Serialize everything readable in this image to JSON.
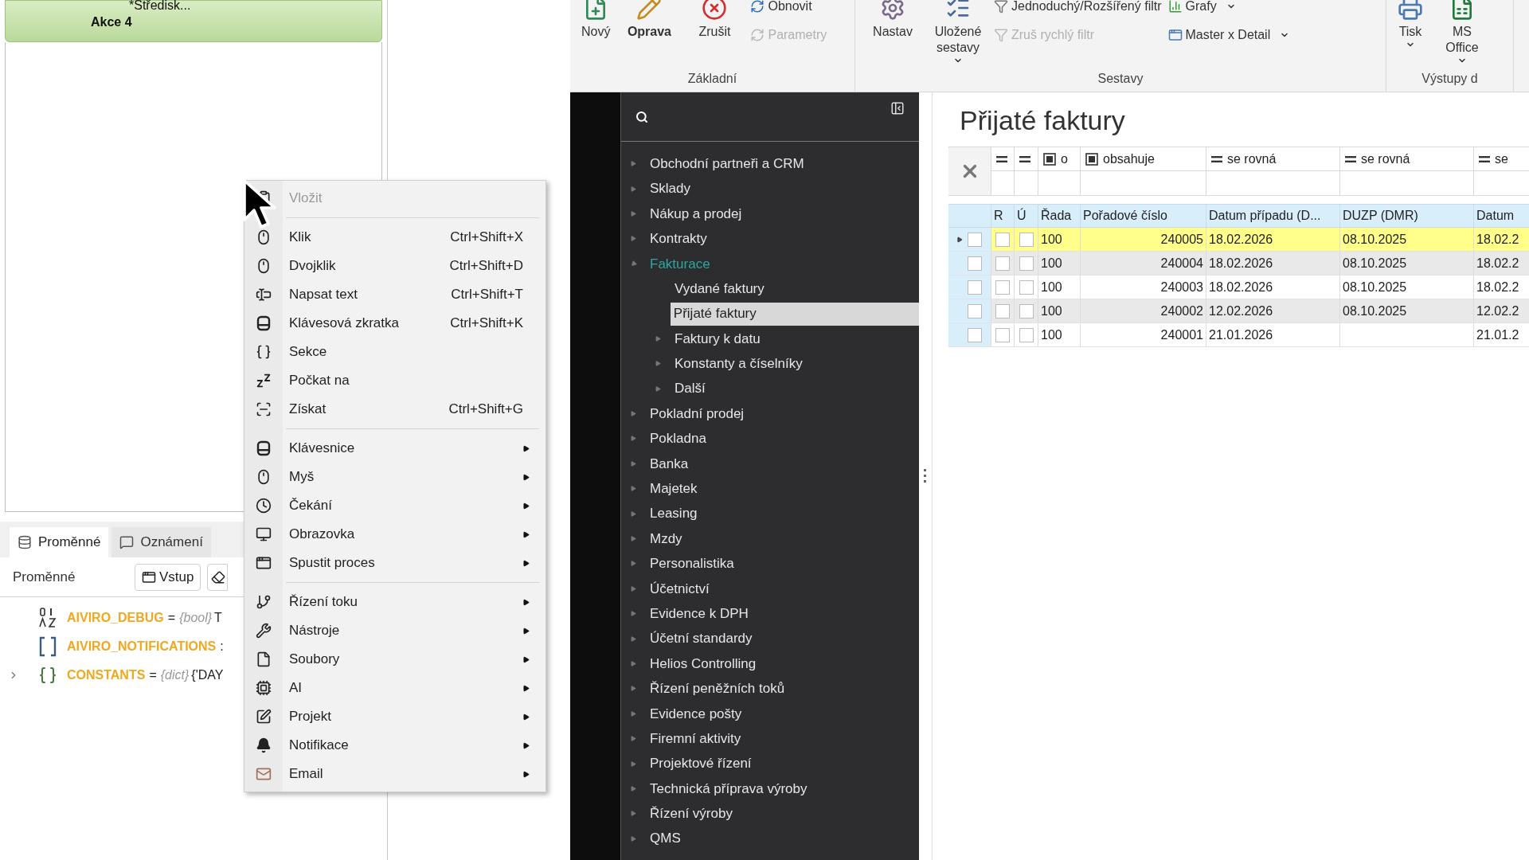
{
  "designer": {
    "card": {
      "lines": [
        "*Středisk...",
        "Akce 4"
      ]
    },
    "tabs": [
      {
        "label": "Proměnné",
        "selected": true
      },
      {
        "label": "Oznámení",
        "selected": false
      }
    ],
    "toolbar": {
      "label": "Proměnné",
      "buttons": [
        {
          "kind": "input",
          "label": "Vstup"
        },
        {
          "kind": "erase"
        }
      ]
    },
    "variables": [
      {
        "kind": "bool",
        "name": "AIVIRO_DEBUG",
        "sep": "=",
        "type": "{bool}",
        "value": "T"
      },
      {
        "kind": "list",
        "name": "AIVIRO_NOTIFICATIONS",
        "sep": ":"
      },
      {
        "kind": "dict",
        "name": "CONSTANTS",
        "sep": "=",
        "type": "{dict}",
        "value": "{'DAY",
        "expanded": false
      }
    ]
  },
  "menu": {
    "sections": [
      {
        "items": [
          {
            "label": "Vložit",
            "disabled": true,
            "submenu": false
          }
        ]
      },
      {
        "items": [
          {
            "label": "Klik",
            "shortcut": "Ctrl+Shift+X",
            "disabled": false,
            "submenu": false
          },
          {
            "label": "Dvojklik",
            "shortcut": "Ctrl+Shift+D",
            "disabled": false,
            "submenu": false
          },
          {
            "label": "Napsat text",
            "shortcut": "Ctrl+Shift+T",
            "disabled": false,
            "submenu": false
          },
          {
            "label": "Klávesová zkratka",
            "shortcut": "Ctrl+Shift+K",
            "disabled": false,
            "submenu": false
          },
          {
            "label": "Sekce",
            "disabled": false,
            "submenu": false
          },
          {
            "label": "Počkat na",
            "disabled": false,
            "submenu": false
          },
          {
            "label": "Získat",
            "shortcut": "Ctrl+Shift+G",
            "disabled": false,
            "submenu": false
          }
        ]
      },
      {
        "items": [
          {
            "label": "Klávesnice",
            "disabled": false,
            "submenu": true
          },
          {
            "label": "Myš",
            "disabled": false,
            "submenu": true
          },
          {
            "label": "Čekání",
            "disabled": false,
            "submenu": true
          },
          {
            "label": "Obrazovka",
            "disabled": false,
            "submenu": true
          },
          {
            "label": "Spustit proces",
            "disabled": false,
            "submenu": true
          }
        ]
      },
      {
        "items": [
          {
            "label": "Řízení toku",
            "disabled": false,
            "submenu": true
          },
          {
            "label": "Nástroje",
            "disabled": false,
            "submenu": true
          },
          {
            "label": "Soubory",
            "disabled": false,
            "submenu": true
          },
          {
            "label": "AI",
            "disabled": false,
            "submenu": true
          },
          {
            "label": "Projekt",
            "disabled": false,
            "submenu": true
          },
          {
            "label": "Notifikace",
            "disabled": false,
            "submenu": true
          },
          {
            "label": "Email",
            "disabled": false,
            "submenu": true
          }
        ]
      }
    ]
  },
  "ribbon": {
    "groups": [
      {
        "label": "Základní",
        "columns": [
          [
            {
              "kind": "large",
              "label": "Nový",
              "disabled": false,
              "primary": false,
              "dropdown": false
            }
          ],
          [
            {
              "kind": "large",
              "label": "Oprava",
              "disabled": false,
              "primary": true,
              "dropdown": false
            }
          ],
          [
            {
              "kind": "large",
              "label": "Zrušit",
              "disabled": false,
              "primary": false,
              "dropdown": false
            }
          ],
          [
            {
              "kind": "small",
              "label": "Obnovit",
              "disabled": false,
              "primary": false,
              "dropdown": false
            },
            {
              "kind": "small",
              "label": "Parametry",
              "disabled": true,
              "primary": false,
              "dropdown": false
            }
          ]
        ]
      },
      {
        "label": "Sestavy",
        "columns": [
          [
            {
              "kind": "large",
              "label": "Nastav",
              "disabled": false,
              "primary": false,
              "dropdown": false
            }
          ],
          [
            {
              "kind": "large",
              "label": "Uložené sestavy",
              "disabled": false,
              "primary": false,
              "dropdown": true
            }
          ],
          [
            {
              "kind": "small",
              "label": "Jednoduchý/Rozšířený filtr",
              "disabled": false,
              "primary": false,
              "dropdown": false
            },
            {
              "kind": "small",
              "label": "Zruš rychlý filtr",
              "disabled": true,
              "primary": false,
              "dropdown": false
            }
          ],
          [
            {
              "kind": "small",
              "label": "Grafy",
              "disabled": false,
              "primary": false,
              "dropdown": true
            },
            {
              "kind": "small",
              "label": "Master x Detail",
              "disabled": false,
              "primary": false,
              "dropdown": true
            }
          ]
        ]
      },
      {
        "label": "Výstupy d",
        "columns": [
          [
            {
              "kind": "large",
              "label": "Tisk",
              "disabled": false,
              "primary": false,
              "dropdown": true
            }
          ],
          [
            {
              "kind": "large",
              "label": "MS Office",
              "disabled": false,
              "primary": false,
              "dropdown": true
            }
          ]
        ]
      }
    ]
  },
  "navigation": {
    "items": [
      {
        "label": "Obchodní partneři a CRM",
        "kind": "branch",
        "expanded": false,
        "selected": false
      },
      {
        "label": "Sklady",
        "kind": "branch",
        "expanded": false,
        "selected": false
      },
      {
        "label": "Nákup a prodej",
        "kind": "branch",
        "expanded": false,
        "selected": false
      },
      {
        "label": "Kontrakty",
        "kind": "branch",
        "expanded": false,
        "selected": false
      },
      {
        "label": "Fakturace",
        "kind": "branch",
        "expanded": true,
        "selected": false,
        "children": [
          {
            "label": "Vydané faktury",
            "kind": "leaf",
            "expanded": false,
            "selected": false
          },
          {
            "label": "Přijaté faktury",
            "kind": "leaf",
            "expanded": false,
            "selected": true
          },
          {
            "label": "Faktury k datu",
            "kind": "branch",
            "expanded": false,
            "selected": false
          },
          {
            "label": "Konstanty a číselníky",
            "kind": "branch",
            "expanded": false,
            "selected": false
          },
          {
            "label": "Další",
            "kind": "branch",
            "expanded": false,
            "selected": false
          }
        ]
      },
      {
        "label": "Pokladní prodej",
        "kind": "branch",
        "expanded": false,
        "selected": false
      },
      {
        "label": "Pokladna",
        "kind": "branch",
        "expanded": false,
        "selected": false
      },
      {
        "label": "Banka",
        "kind": "branch",
        "expanded": false,
        "selected": false
      },
      {
        "label": "Majetek",
        "kind": "branch",
        "expanded": false,
        "selected": false
      },
      {
        "label": "Leasing",
        "kind": "branch",
        "expanded": false,
        "selected": false
      },
      {
        "label": "Mzdy",
        "kind": "branch",
        "expanded": false,
        "selected": false
      },
      {
        "label": "Personalistika",
        "kind": "branch",
        "expanded": false,
        "selected": false
      },
      {
        "label": "Účetnictví",
        "kind": "branch",
        "expanded": false,
        "selected": false
      },
      {
        "label": "Evidence k DPH",
        "kind": "branch",
        "expanded": false,
        "selected": false
      },
      {
        "label": "Účetní standardy",
        "kind": "branch",
        "expanded": false,
        "selected": false
      },
      {
        "label": "Helios Controlling",
        "kind": "branch",
        "expanded": false,
        "selected": false
      },
      {
        "label": "Řízení peněžních toků",
        "kind": "branch",
        "expanded": false,
        "selected": false
      },
      {
        "label": "Evidence pošty",
        "kind": "branch",
        "expanded": false,
        "selected": false
      },
      {
        "label": "Firemní aktivity",
        "kind": "branch",
        "expanded": false,
        "selected": false
      },
      {
        "label": "Projektové řízení",
        "kind": "branch",
        "expanded": false,
        "selected": false
      },
      {
        "label": "Technická příprava výroby",
        "kind": "branch",
        "expanded": false,
        "selected": false
      },
      {
        "label": "Řízení výroby",
        "kind": "branch",
        "expanded": false,
        "selected": false
      },
      {
        "label": "QMS",
        "kind": "branch",
        "expanded": false,
        "selected": false
      }
    ]
  },
  "content": {
    "title": "Přijaté faktury",
    "filters": [
      {
        "kind": "equals"
      },
      {
        "kind": "equals"
      },
      {
        "kind": "contains",
        "text": "o"
      },
      {
        "kind": "contains",
        "text": "obsahuje"
      },
      {
        "kind": "equals",
        "text": "se rovná"
      },
      {
        "kind": "equals",
        "text": "se rovná"
      },
      {
        "kind": "equals",
        "text": "se"
      }
    ],
    "table": {
      "check_columns": [
        "R",
        "Ú"
      ],
      "columns": [
        "Řada",
        "Pořadové číslo",
        "Datum případu (D...",
        "DUZP (DMR)",
        "Datum"
      ],
      "rows": [
        {
          "selected": true,
          "checks": [
            false,
            false,
            false
          ],
          "cells": [
            "100",
            "240005",
            "18.02.2026",
            "08.10.2025",
            "18.02.2"
          ]
        },
        {
          "selected": false,
          "checks": [
            false,
            false,
            false
          ],
          "cells": [
            "100",
            "240004",
            "18.02.2026",
            "08.10.2025",
            "18.02.2"
          ]
        },
        {
          "selected": false,
          "checks": [
            false,
            false,
            false
          ],
          "cells": [
            "100",
            "240003",
            "18.02.2026",
            "08.10.2025",
            "18.02.2"
          ]
        },
        {
          "selected": false,
          "checks": [
            false,
            false,
            false
          ],
          "cells": [
            "100",
            "240002",
            "12.02.2026",
            "08.10.2025",
            "12.02.2"
          ]
        },
        {
          "selected": false,
          "checks": [
            false,
            false,
            false
          ],
          "cells": [
            "100",
            "240001",
            "21.01.2026",
            "",
            "21.01.2"
          ]
        }
      ]
    }
  }
}
